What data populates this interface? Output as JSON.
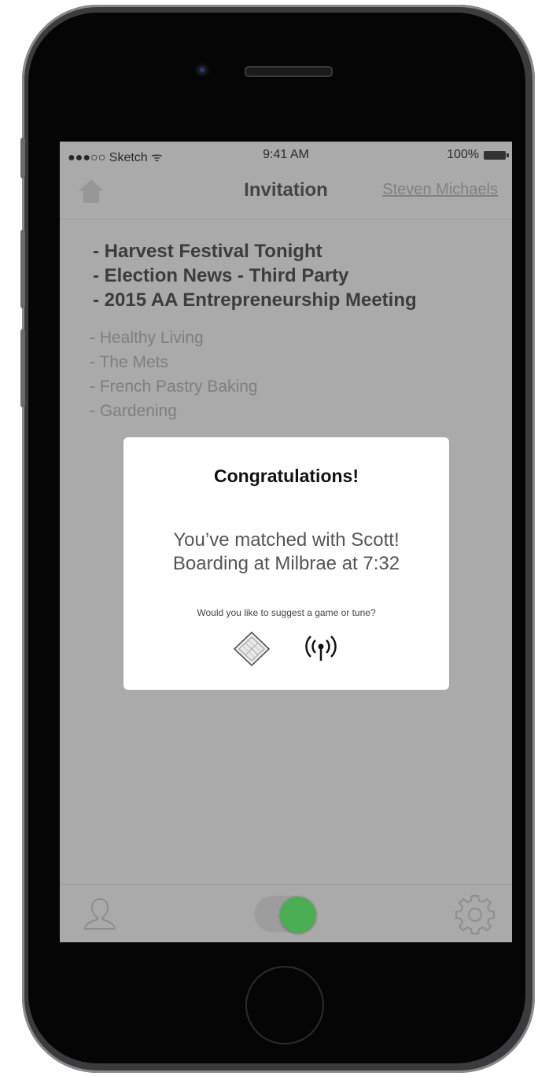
{
  "status_bar": {
    "carrier": "●●●○○ Sketch ᯤ",
    "time": "9:41 AM",
    "battery": "100%"
  },
  "nav": {
    "title": "Invitation",
    "user_link": "Steven Michaels",
    "home_icon": "home-icon"
  },
  "topics": {
    "primary": [
      "- Harvest Festival Tonight",
      "- Election News - Third Party",
      "- 2015 AA Entrepreneurship Meeting"
    ],
    "secondary": [
      "- Healthy Living",
      "- The Mets",
      "- French Pastry Baking",
      "- Gardening"
    ]
  },
  "modal": {
    "title": "Congratulations!",
    "message_line1": "You’ve matched with Scott!",
    "message_line2": "Boarding at Milbrae at 7:32",
    "prompt": "Would you like to suggest a game or tune?",
    "actions": [
      "game-board-icon",
      "broadcast-icon"
    ]
  },
  "tab_bar": {
    "items": [
      "profile-icon",
      "toggle-switch",
      "gear-icon"
    ],
    "toggle_on": true,
    "toggle_color": "#4cae52"
  },
  "colors": {
    "overlay": "#aaaaaa",
    "modal_bg": "#ffffff",
    "accent_green": "#4cae52"
  }
}
